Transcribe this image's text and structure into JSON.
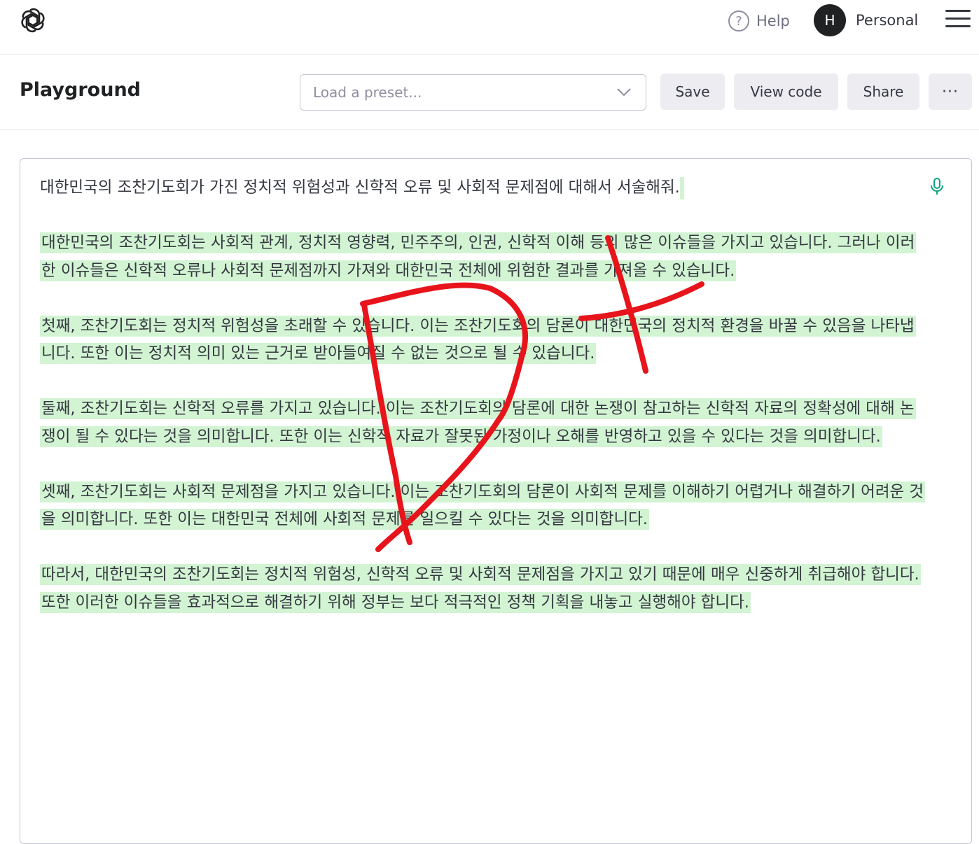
{
  "header": {
    "help_label": "Help",
    "avatar_initial": "H",
    "account_label": "Personal"
  },
  "toolbar": {
    "title": "Playground",
    "preset_placeholder": "Load a preset...",
    "save_label": "Save",
    "view_code_label": "View code",
    "share_label": "Share",
    "more_label": "···"
  },
  "editor": {
    "prompt": "대한민국의 조찬기도회가 가진 정치적 위험성과 신학적 오류 및 사회적 문제점에 대해서 서술해줘.",
    "completion": [
      "대한민국의 조찬기도회는 사회적 관계, 정치적 영향력, 민주주의, 인권, 신학적 이해 등의 많은 이슈들을 가지고 있습니다. 그러나 이러한 이슈들은 신학적 오류나 사회적 문제점까지 가져와 대한민국 전체에 위험한 결과를 가져올 수 있습니다.",
      "첫째, 조찬기도회는 정치적 위험성을 초래할 수 있습니다. 이는 조찬기도회의 담론이 대한민국의 정치적 환경을 바꿀 수 있음을 나타냅니다. 또한 이는 정치적 의미 있는 근거로 받아들여질 수 없는 것으로 될 수 있습니다.",
      "둘째, 조찬기도회는 신학적 오류를 가지고 있습니다. 이는 조찬기도회의 담론에 대한 논쟁이 참고하는 신학적 자료의 정확성에 대해 논쟁이 될 수 있다는 것을 의미합니다. 또한 이는 신학적 자료가 잘못된 가정이나 오해를 반영하고 있을 수 있다는 것을 의미합니다.",
      "셋째, 조찬기도회는 사회적 문제점을 가지고 있습니다. 이는 조찬기도회의 담론이 사회적 문제를 이해하기 어렵거나 해결하기 어려운 것을 의미합니다. 또한 이는 대한민국 전체에 사회적 문제를 일으킬 수 있다는 것을 의미합니다.",
      "따라서, 대한민국의 조찬기도회는 정치적 위험성, 신학적 오류 및 사회적 문제점을 가지고 있기 때문에 매우 신중하게 취급해야 합니다. 또한 이러한 이슈들을 효과적으로 해결하기 위해 정부는 보다 적극적인 정책 기획을 내놓고 실행해야 합니다."
    ]
  },
  "annotation": {
    "color": "#e8141b"
  },
  "colors": {
    "highlight": "#d2f4d3",
    "mic": "#10a37f"
  }
}
